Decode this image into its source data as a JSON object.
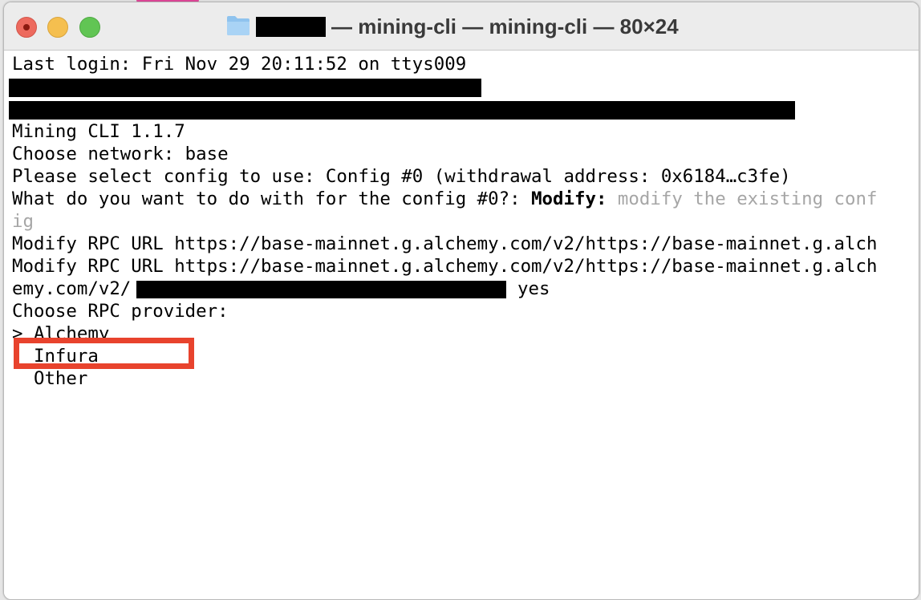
{
  "window": {
    "title": "— mining-cli — mining-cli — 80×24",
    "icons": {
      "folder": "folder-icon"
    }
  },
  "terminal": {
    "last_login": "Last login: Fri Nov 29 20:11:52 on ttys009",
    "version": "Mining CLI 1.1.7",
    "choose_network": "Choose network: base",
    "select_config": "Please select config to use: Config #0 (withdrawal address: 0x6184…c3fe)",
    "what_to_do_prefix": "What do you want to do with for the config #0?: ",
    "what_to_do_bold": "Modify:",
    "what_to_do_hint": " modify the existing conf",
    "what_to_do_hint_wrap": "ig",
    "modify_rpc_1": "Modify RPC URL https://base-mainnet.g.alchemy.com/v2/https://base-mainnet.g.alch",
    "modify_rpc_2": "Modify RPC URL https://base-mainnet.g.alchemy.com/v2/https://base-mainnet.g.alch",
    "modify_rpc_2_wrap": "emy.com/v2/",
    "modify_rpc_2_answer": "yes",
    "choose_provider": "Choose RPC provider:",
    "options": [
      {
        "label": "> Alchemy"
      },
      {
        "label": "  Infura"
      },
      {
        "label": "  Other"
      }
    ]
  },
  "colors": {
    "highlight_border": "#e8432d",
    "hint_text": "#a6a6a6"
  }
}
